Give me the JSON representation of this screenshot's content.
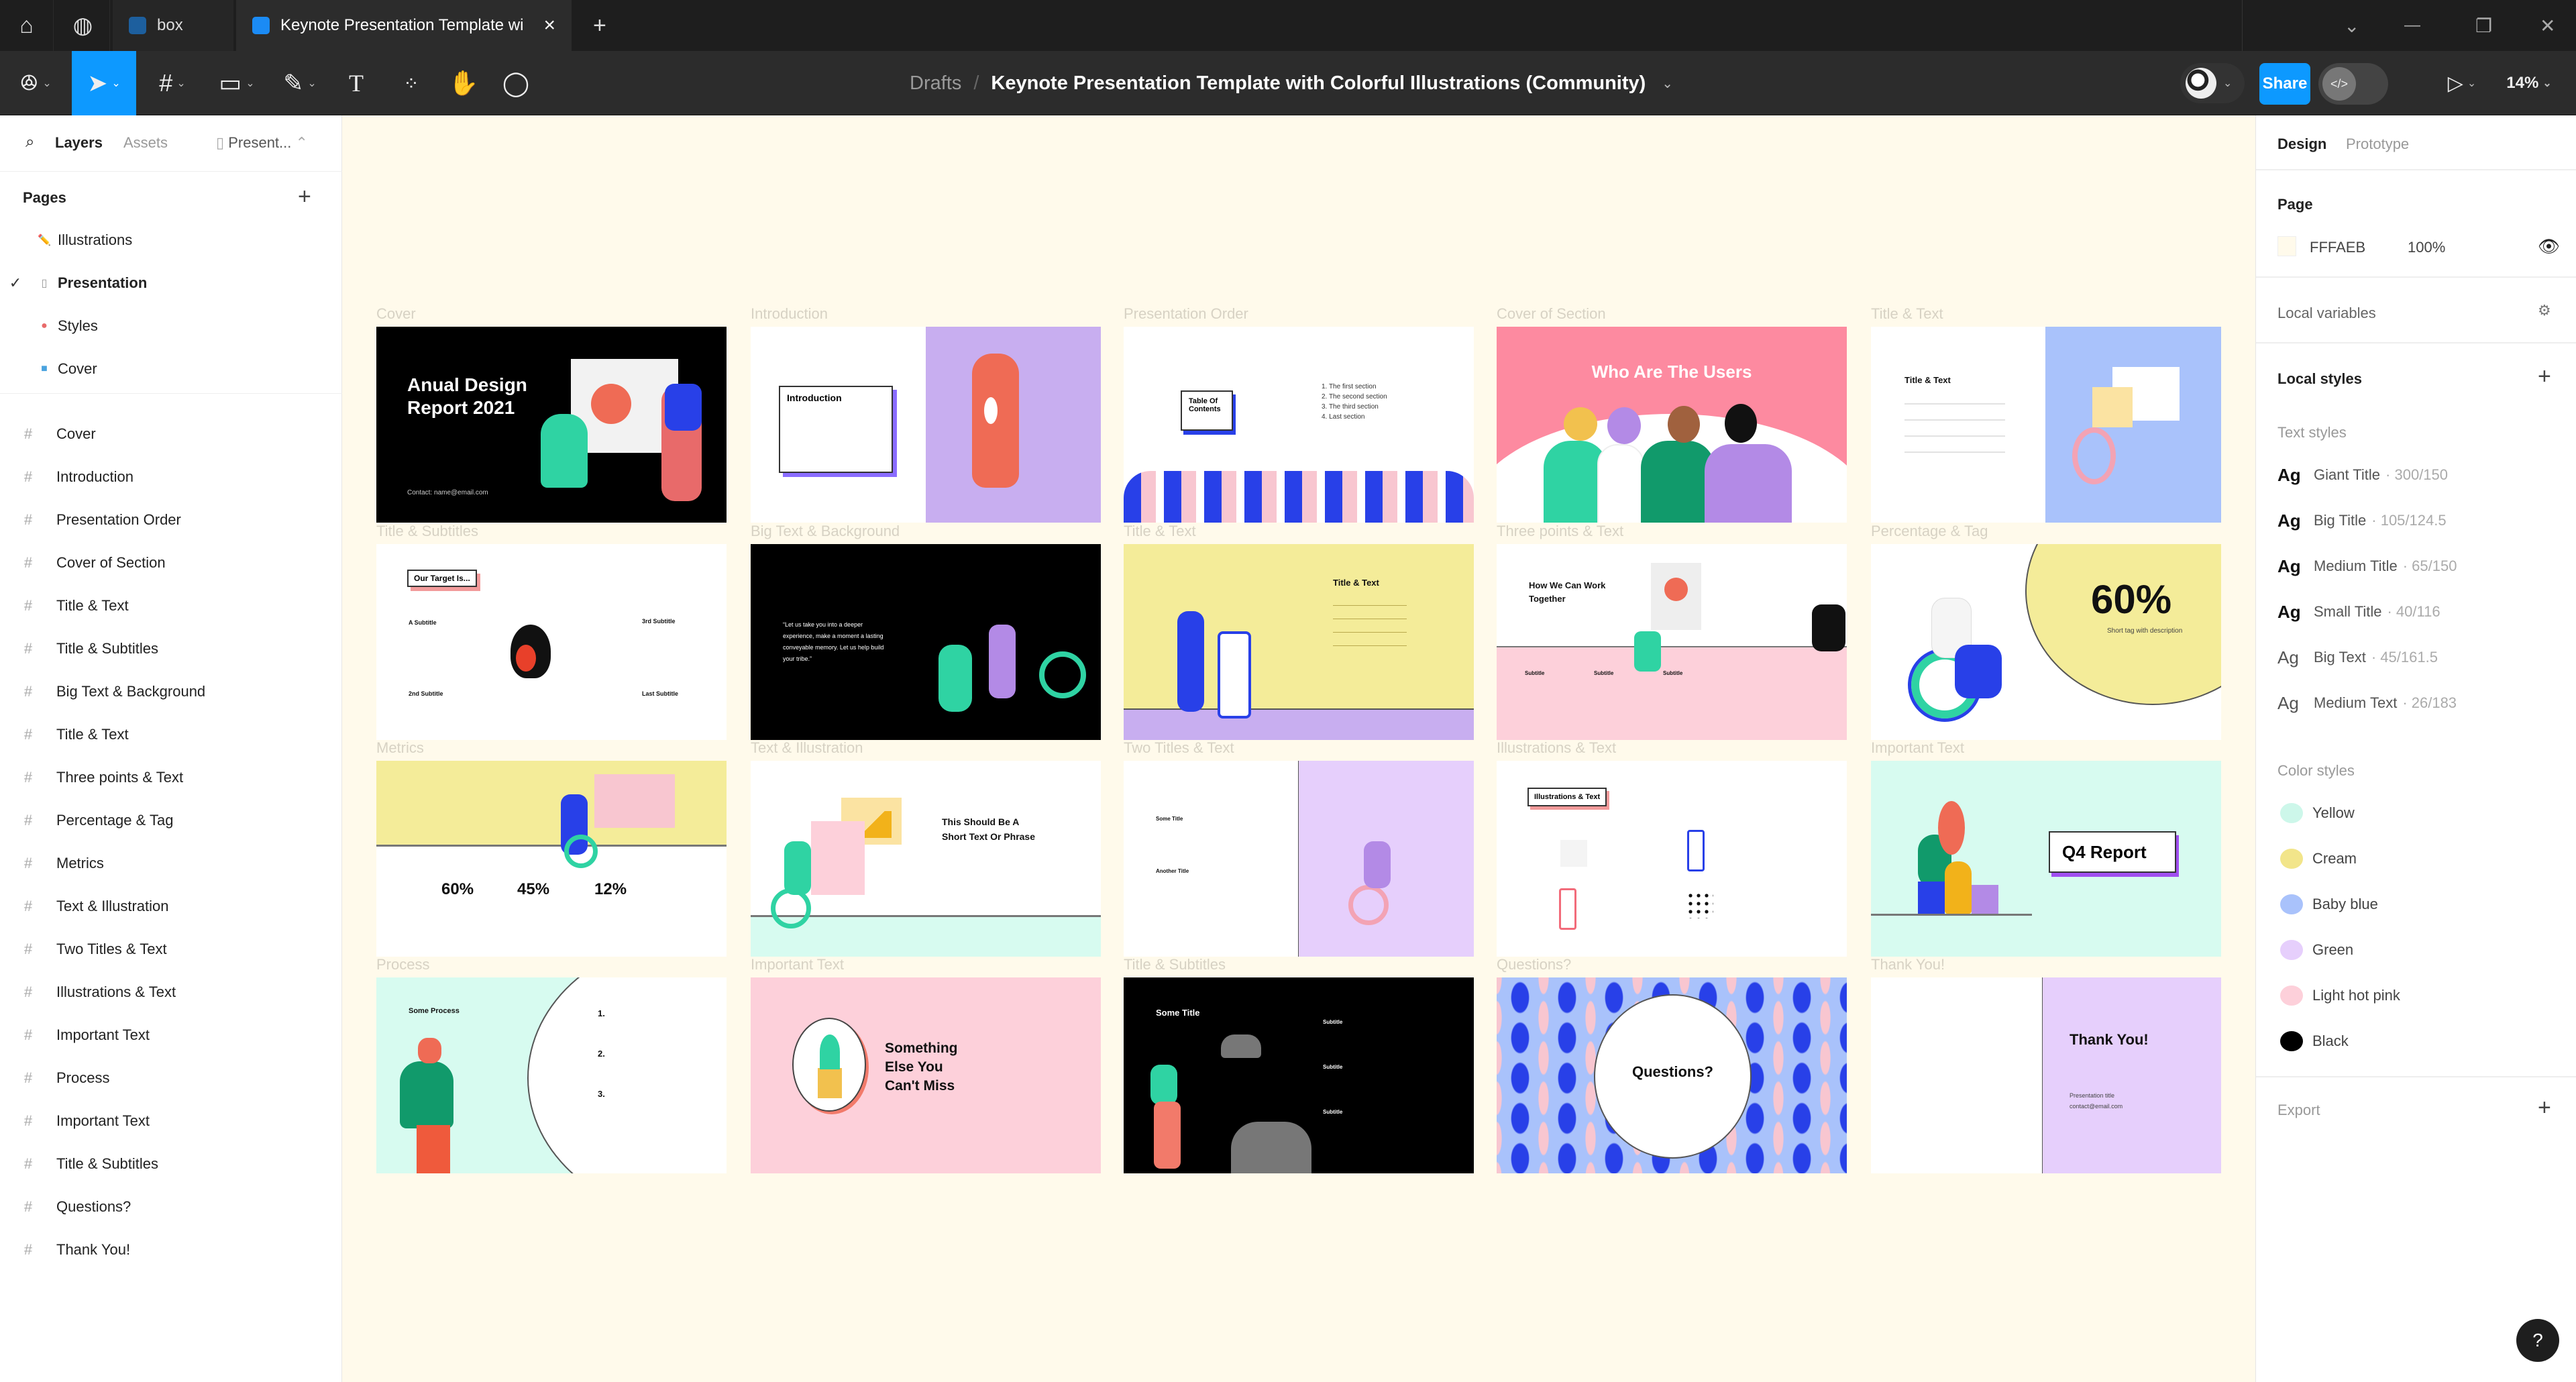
{
  "tabs": {
    "home_icon": "home-icon",
    "community_icon": "globe-icon",
    "items": [
      {
        "label": "box"
      },
      {
        "label": "Keynote Presentation Template wi",
        "close": "×"
      }
    ],
    "new_tab": "+"
  },
  "window": {
    "chevron": "⌄",
    "minimize": "—",
    "restore": "❐",
    "close": "✕"
  },
  "toolbar": {
    "breadcrumb_root": "Drafts",
    "separator": "/",
    "file_title": "Keynote Presentation Template with Colorful Illustrations (Community)",
    "share": "Share",
    "zoom": "14%",
    "dev_mode": "</>"
  },
  "left_panel": {
    "tabs": [
      "Layers",
      "Assets"
    ],
    "page_selector": "Present...",
    "pages_header": "Pages",
    "pages": [
      {
        "label": "Illustrations",
        "icon": "✏️",
        "color": "#e8553d"
      },
      {
        "label": "Presentation",
        "icon": "▯",
        "selected": true,
        "color": "#999"
      },
      {
        "label": "Styles",
        "icon": "●",
        "color": "#e86a6a"
      },
      {
        "label": "Cover",
        "icon": "■",
        "color": "#4aa3df"
      }
    ],
    "layers": [
      "Cover",
      "Introduction",
      "Presentation Order",
      "Cover of Section",
      "Title & Text",
      "Title & Subtitles",
      "Big Text & Background",
      "Title & Text",
      "Three points & Text",
      "Percentage & Tag",
      "Metrics",
      "Text & Illustration",
      "Two Titles & Text",
      "Illustrations & Text",
      "Important Text",
      "Process",
      "Important Text",
      "Title & Subtitles",
      "Questions?",
      "Thank You!"
    ]
  },
  "right_panel": {
    "tabs": [
      "Design",
      "Prototype"
    ],
    "page_header": "Page",
    "page_color": "FFFAEB",
    "page_color_hex": "#fffaeb",
    "page_opacity": "100%",
    "local_variables": "Local variables",
    "local_styles": "Local styles",
    "text_styles_header": "Text styles",
    "text_styles": [
      {
        "ag": "Ag",
        "name": "Giant Title",
        "meta": "· 300/150",
        "bold": true
      },
      {
        "ag": "Ag",
        "name": "Big Title",
        "meta": "· 105/124.5",
        "bold": true
      },
      {
        "ag": "Ag",
        "name": "Medium Title",
        "meta": "· 65/150",
        "bold": true
      },
      {
        "ag": "Ag",
        "name": "Small Title",
        "meta": "· 40/116",
        "bold": true
      },
      {
        "ag": "Ag",
        "name": "Big Text",
        "meta": "· 45/161.5",
        "bold": false
      },
      {
        "ag": "Ag",
        "name": "Medium Text",
        "meta": "· 26/183",
        "bold": false
      }
    ],
    "color_styles_header": "Color styles",
    "color_styles": [
      {
        "name": "Yellow",
        "hex": "#cdf7ea"
      },
      {
        "name": "Cream",
        "hex": "#f2e58a"
      },
      {
        "name": "Baby blue",
        "hex": "#a9c2fb"
      },
      {
        "name": "Green",
        "hex": "#e6cffc"
      },
      {
        "name": "Light hot pink",
        "hex": "#fdd0da"
      },
      {
        "name": "Black",
        "hex": "#000000"
      }
    ],
    "export": "Export",
    "help": "?"
  },
  "canvas": {
    "background": "#fffaeb",
    "slides": [
      {
        "label": "Cover",
        "title": "Anual Design Report 2021",
        "contact": "Contact: name@email.com"
      },
      {
        "label": "Introduction",
        "title": "Introduction"
      },
      {
        "label": "Presentation Order",
        "title": "Table Of Contents",
        "items": [
          "1. The first section",
          "2. The second section",
          "3. The third section",
          "4. Last section"
        ]
      },
      {
        "label": "Cover of Section",
        "title": "Who Are The Users"
      },
      {
        "label": "Title & Text",
        "title": "Title & Text"
      },
      {
        "label": "Title & Subtitles",
        "title": "Our Target Is...",
        "subs": [
          "A Subtitle",
          "3rd Subtitle",
          "2nd Subtitle",
          "Last Subtitle"
        ]
      },
      {
        "label": "Big Text & Background",
        "quote": "“Let us take you into a deeper experience, make a moment a lasting conveyable memory. Let us help build your tribe.”"
      },
      {
        "label": "Title & Text",
        "title": "Title & Text"
      },
      {
        "label": "Three points & Text",
        "title": "How We Can Work Together",
        "subs": [
          "Subtitle",
          "Subtitle",
          "Subtitle"
        ]
      },
      {
        "label": "Percentage & Tag",
        "value": "60%",
        "tag": "Short tag with description"
      },
      {
        "label": "Metrics",
        "values": [
          "60%",
          "45%",
          "12%"
        ]
      },
      {
        "label": "Text & Illustration",
        "title": "This Should Be A Short Text Or Phrase"
      },
      {
        "label": "Two Titles & Text",
        "titles": [
          "Some Title",
          "Another Title"
        ]
      },
      {
        "label": "Illustrations & Text",
        "title": "Illustrations & Text"
      },
      {
        "label": "Important Text",
        "title": "Q4 Report"
      },
      {
        "label": "Process",
        "title": "Some Process",
        "steps": [
          "1.",
          "2.",
          "3."
        ]
      },
      {
        "label": "Important Text",
        "title": "Something Else You Can't Miss"
      },
      {
        "label": "Title & Subtitles",
        "title": "Some Title",
        "subs": [
          "Subtitle",
          "Subtitle",
          "Subtitle"
        ]
      },
      {
        "label": "Questions?",
        "title": "Questions?"
      },
      {
        "label": "Thank You!",
        "title": "Thank You!",
        "lines": [
          "Presentation title",
          "contact@email.com"
        ]
      }
    ]
  }
}
